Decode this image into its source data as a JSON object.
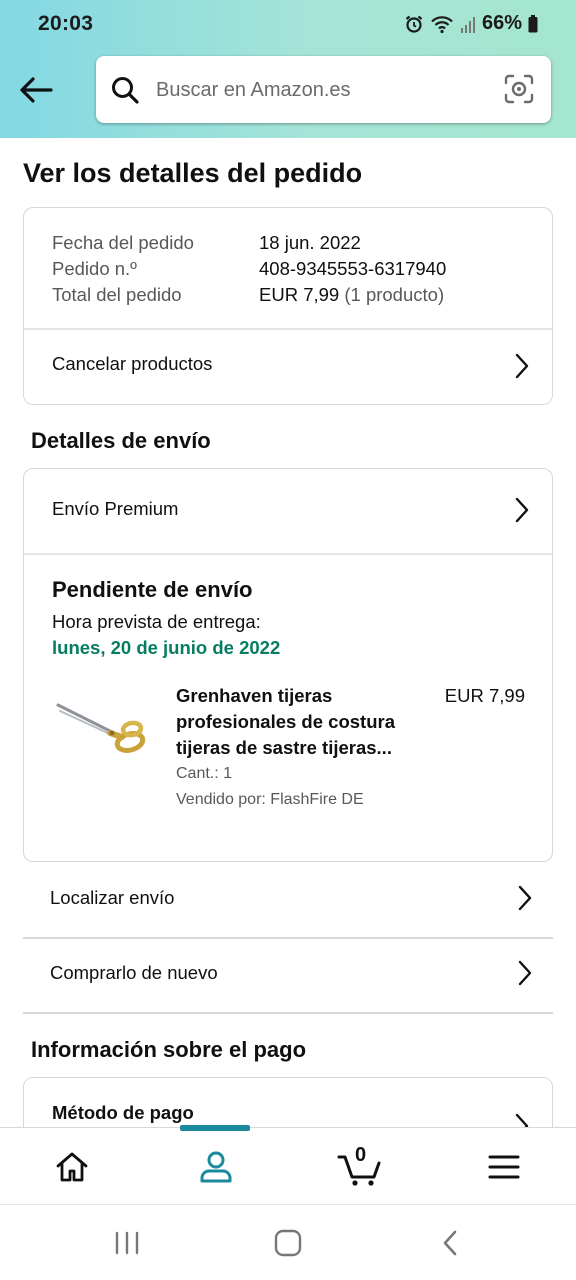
{
  "status_bar": {
    "time": "20:03",
    "battery": "66%"
  },
  "search": {
    "placeholder": "Buscar en Amazon.es"
  },
  "page": {
    "title": "Ver los detalles del pedido"
  },
  "order_summary": {
    "rows": [
      {
        "label": "Fecha del pedido",
        "value": "18 jun. 2022",
        "extra": ""
      },
      {
        "label": "Pedido n.º",
        "value": "408-9345553-6317940",
        "extra": ""
      },
      {
        "label": "Total del pedido",
        "value": "EUR 7,99",
        "extra": "(1 producto)"
      }
    ],
    "cancel_label": "Cancelar productos"
  },
  "shipping": {
    "section_title": "Detalles de envío",
    "method": "Envío Premium",
    "status_title": "Pendiente de envío",
    "eta_label": "Hora prevista de entrega:",
    "eta_date": "lunes, 20 de junio de 2022",
    "product": {
      "title": "Grenhaven tijeras profesionales de costura tijeras de sastre tijeras...",
      "price": "EUR 7,99",
      "qty": "Cant.: 1",
      "seller": "Vendido por: FlashFire DE"
    },
    "track_label": "Localizar envío",
    "buy_again_label": "Comprarlo de nuevo"
  },
  "payment": {
    "section_title": "Información sobre el pago",
    "method_title": "Método de pago"
  },
  "bottom_nav": {
    "items": [
      "home-icon",
      "account-icon",
      "cart-icon",
      "menu-icon"
    ],
    "active": "account-icon",
    "cart_count": "0"
  },
  "colors": {
    "accent": "#1a8a9c",
    "delivery_green": "#067d62",
    "header_gradient_start": "#82d8e3",
    "header_gradient_end": "#a5e6cf"
  }
}
